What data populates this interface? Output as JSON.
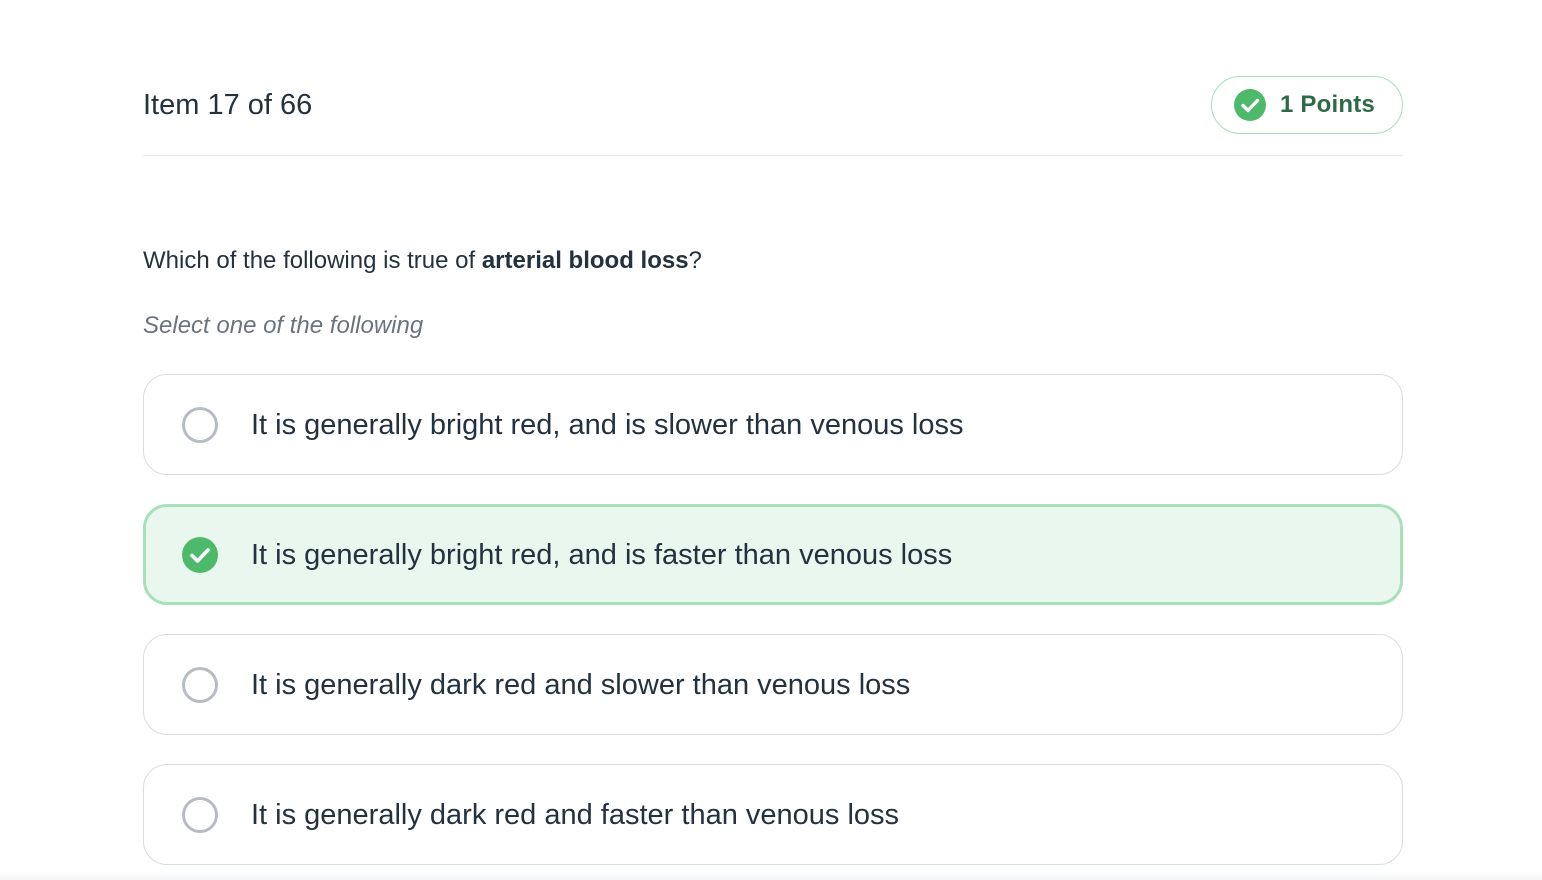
{
  "header": {
    "item_counter": "Item 17 of 66",
    "points_label": "1 Points",
    "points_icon": "check-circle-icon"
  },
  "question": {
    "prefix": "Which of the following is true of ",
    "emphasis": "arterial blood loss",
    "suffix": "?"
  },
  "instruction": "Select one of the following",
  "options": [
    {
      "label": "It is generally bright red, and is slower than venous loss",
      "selected": false
    },
    {
      "label": "It is generally bright red, and is faster than venous loss",
      "selected": true
    },
    {
      "label": "It is generally dark red and slower than venous loss",
      "selected": false
    },
    {
      "label": "It is generally dark red and faster than venous loss",
      "selected": false
    }
  ],
  "colors": {
    "accent_green": "#4cba6a",
    "selected_background": "#eaf7ee",
    "selected_border": "#a8e0bb",
    "text": "#24313f",
    "muted_text": "#6b7380"
  }
}
